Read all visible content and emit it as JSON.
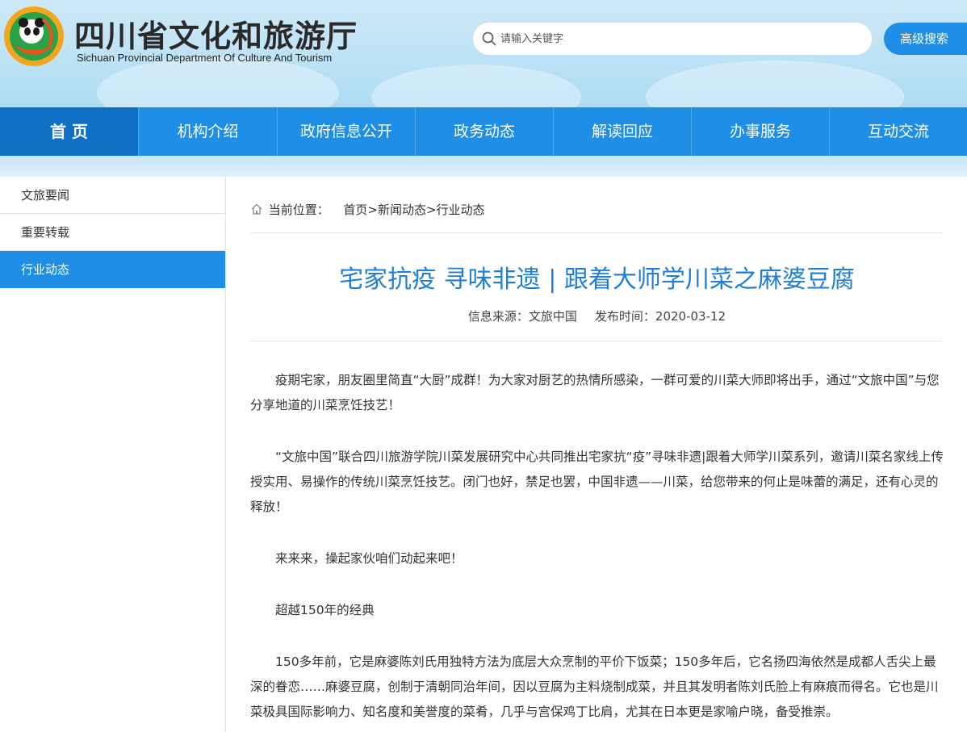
{
  "header": {
    "title": "四川省文化和旅游厅",
    "subtitle": "Sichuan Provincial Department Of Culture And Tourism",
    "logo_icon": "panda-logo-icon",
    "brand_color": "#1f8ee6"
  },
  "search": {
    "placeholder": "请输入关键字",
    "advanced_label": "高级搜索"
  },
  "nav": {
    "items": [
      {
        "label": "首 页",
        "active": true
      },
      {
        "label": "机构介绍"
      },
      {
        "label": "政府信息公开"
      },
      {
        "label": "政务动态"
      },
      {
        "label": "解读回应"
      },
      {
        "label": "办事服务"
      },
      {
        "label": "互动交流"
      }
    ]
  },
  "sidebar": {
    "items": [
      {
        "label": "文旅要闻"
      },
      {
        "label": "重要转载"
      },
      {
        "label": "行业动态",
        "active": true
      }
    ]
  },
  "breadcrumb": {
    "prefix": "当前位置：",
    "items": [
      "首页",
      "新闻动态",
      "行业动态"
    ],
    "separator": ">"
  },
  "article": {
    "title": "宅家抗疫 寻味非遗 | 跟着大师学川菜之麻婆豆腐",
    "source": "信息来源：文旅中国",
    "date": "发布时间：2020-03-12",
    "paragraphs": [
      "疫期宅家，朋友圈里简直“大厨”成群！为大家对厨艺的热情所感染，一群可爱的川菜大师即将出手，通过“文旅中国”与您分享地道的川菜烹饪技艺！",
      "“文旅中国”联合四川旅游学院川菜发展研究中心共同推出宅家抗“疫”寻味非遗|跟着大师学川菜系列，邀请川菜名家线上传授实用、易操作的传统川菜烹饪技艺。闭门也好，禁足也罢，中国非遗——川菜，给您带来的何止是味蕾的满足，还有心灵的释放！",
      "来来来，操起家伙咱们动起来吧！",
      "超越150年的经典",
      "150多年前，它是麻婆陈刘氏用独特方法为底层大众烹制的平价下饭菜；150多年后，它名扬四海依然是成都人舌尖上最深的眷恋……麻婆豆腐，创制于清朝同治年间，因以豆腐为主料烧制成菜，并且其发明者陈刘氏脸上有麻痕而得名。它也是川菜极具国际影响力、知名度和美誉度的菜肴，几乎与宫保鸡丁比肩，尤其在日本更是家喻户晓，备受推崇。"
    ]
  }
}
